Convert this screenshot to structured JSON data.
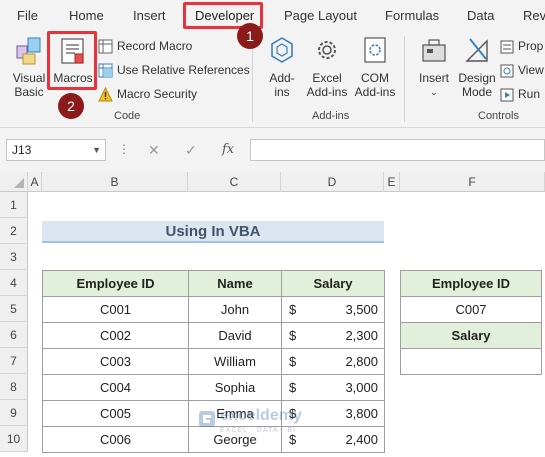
{
  "tabs": [
    "File",
    "Home",
    "Insert",
    "Developer",
    "Page Layout",
    "Formulas",
    "Data",
    "Rev"
  ],
  "steps": {
    "one": "1",
    "two": "2"
  },
  "ribbon": {
    "code": {
      "visual_basic": [
        "Visual",
        "Basic"
      ],
      "macros": "Macros",
      "record_macro": "Record Macro",
      "use_relative": "Use Relative References",
      "macro_security": "Macro Security",
      "label": "Code"
    },
    "addins": {
      "addins": [
        "Add-",
        "ins"
      ],
      "excel_addins": [
        "Excel",
        "Add-ins"
      ],
      "com_addins": [
        "COM",
        "Add-ins"
      ],
      "label": "Add-ins"
    },
    "controls": {
      "insert": "Insert",
      "design_mode": [
        "Design",
        "Mode"
      ],
      "properties": "Prop",
      "view": "View",
      "run": "Run",
      "label": "Controls"
    }
  },
  "formula_bar": {
    "name_box": "J13",
    "fx": "fx",
    "value": ""
  },
  "columns": [
    "A",
    "B",
    "C",
    "D",
    "E",
    "F"
  ],
  "rows": [
    "1",
    "2",
    "3",
    "4",
    "5",
    "6",
    "7",
    "8",
    "9",
    "10"
  ],
  "sheet": {
    "title": "Using In VBA",
    "headers": [
      "Employee ID",
      "Name",
      "Salary"
    ],
    "currency": "$",
    "records": [
      {
        "id": "C001",
        "name": "John",
        "salary": "3,500"
      },
      {
        "id": "C002",
        "name": "David",
        "salary": "2,300"
      },
      {
        "id": "C003",
        "name": "William",
        "salary": "2,800"
      },
      {
        "id": "C004",
        "name": "Sophia",
        "salary": "3,000"
      },
      {
        "id": "C005",
        "name": "Emma",
        "salary": "3,800"
      },
      {
        "id": "C006",
        "name": "George",
        "salary": "2,400"
      }
    ],
    "lookup": {
      "id_header": "Employee ID",
      "id_value": "C007",
      "salary_header": "Salary",
      "salary_value": ""
    }
  },
  "watermark": {
    "name": "exceldemy",
    "tagline": "EXCEL · DATA · BI"
  },
  "colors": {
    "highlight": "#e8323c",
    "step_badge": "#8b1a1a",
    "header_fill": "#e2efda",
    "title_fill": "#dce6f1",
    "title_text": "#44546a"
  }
}
